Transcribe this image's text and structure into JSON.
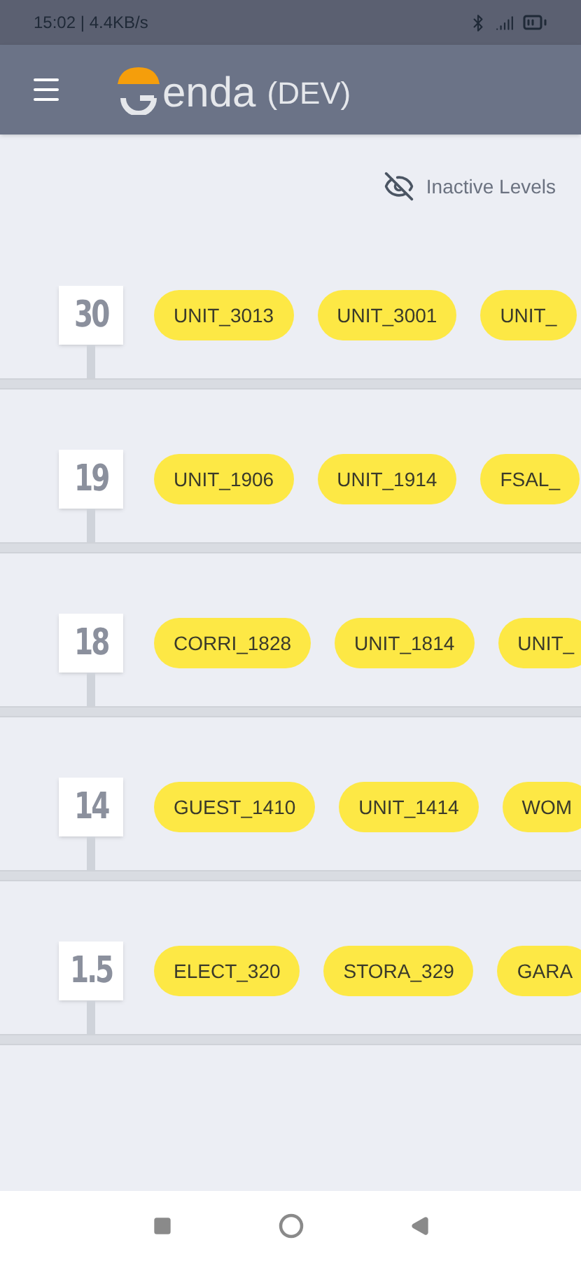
{
  "status_bar": {
    "time": "15:02 | 4.4KB/s"
  },
  "app_bar": {
    "title": "enda",
    "badge": "(DEV)"
  },
  "filter": {
    "label": "Inactive Levels"
  },
  "levels": [
    {
      "number": "30",
      "units": [
        "UNIT_3013",
        "UNIT_3001",
        "UNIT_"
      ]
    },
    {
      "number": "19",
      "units": [
        "UNIT_1906",
        "UNIT_1914",
        "FSAL_"
      ]
    },
    {
      "number": "18",
      "units": [
        "CORRI_1828",
        "UNIT_1814",
        "UNIT_"
      ]
    },
    {
      "number": "14",
      "units": [
        "GUEST_1410",
        "UNIT_1414",
        "WOM"
      ]
    },
    {
      "number": "1.5",
      "units": [
        "ELECT_320",
        "STORA_329",
        "GARA"
      ]
    }
  ]
}
